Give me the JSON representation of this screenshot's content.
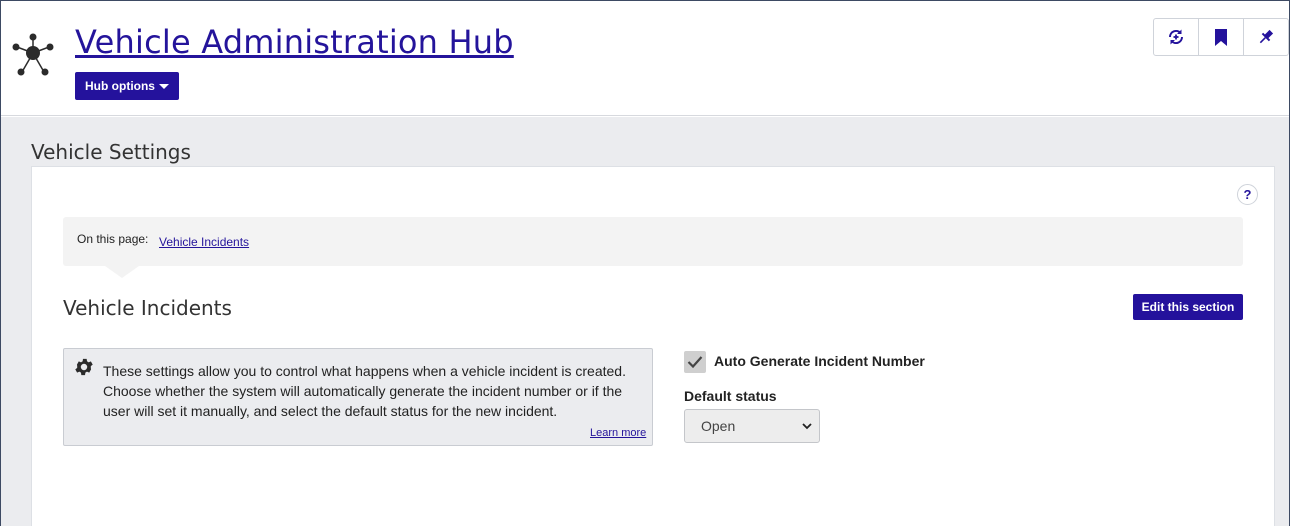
{
  "header": {
    "title": "Vehicle Administration Hub",
    "hub_options_label": "Hub options",
    "actions": [
      {
        "icon": "sync-add-icon",
        "label": "Follow"
      },
      {
        "icon": "bookmark-icon",
        "label": "Bookmark"
      },
      {
        "icon": "pin-icon",
        "label": "Pin"
      }
    ]
  },
  "page": {
    "settings_title": "Vehicle Settings",
    "help_label": "?",
    "on_this_page": {
      "label": "On this page:",
      "link": "Vehicle Incidents"
    }
  },
  "section": {
    "title": "Vehicle Incidents",
    "edit_label": "Edit this section",
    "info": {
      "icon": "gear-icon",
      "text": "These settings allow you to control what happens when a vehicle incident is created. Choose whether the system will automatically generate the incident number or if the user will set it manually, and select the default status for the new incident.",
      "learn_more": "Learn more"
    },
    "auto_generate": {
      "label": "Auto Generate Incident Number",
      "checked": true
    },
    "default_status": {
      "label": "Default status",
      "value": "Open"
    }
  },
  "colors": {
    "brand": "#24129c",
    "link": "#24149b",
    "background": "#ebecef"
  }
}
